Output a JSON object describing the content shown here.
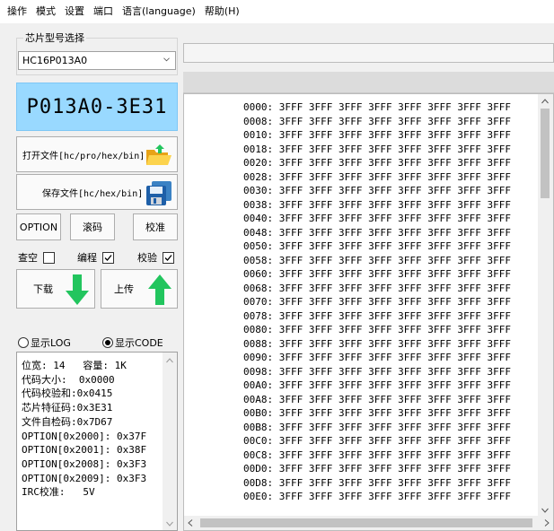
{
  "menu": [
    "操作",
    "模式",
    "设置",
    "端口",
    "语言(language)",
    "帮助(H)"
  ],
  "chip_select": {
    "legend": "芯片型号选择",
    "value": "HC16P013A0"
  },
  "chip_display": "P013A0-3E31",
  "buttons": {
    "open_file": "打开文件[hc/pro/hex/bin]",
    "save_file": "保存文件[hc/hex/bin]",
    "option": "OPTION",
    "roll_code": "滚码",
    "verify": "校准",
    "download": "下载",
    "upload": "上传"
  },
  "checkboxes": [
    {
      "label": "查空",
      "checked": false
    },
    {
      "label": "编程",
      "checked": true
    },
    {
      "label": "校验",
      "checked": true
    }
  ],
  "radios": [
    {
      "label": "显示LOG",
      "selected": false
    },
    {
      "label": "显示CODE",
      "selected": true
    }
  ],
  "info_lines": [
    "位宽: 14   容量: 1K",
    "代码大小:  0x0000",
    "代码校验和:0x0415",
    "芯片特征码:0x3E31",
    "文件自检码:0x7D67",
    "OPTION[0x2000]: 0x37F",
    "OPTION[0x2001]: 0x38F",
    "OPTION[0x2008]: 0x3F3",
    "OPTION[0x2009]: 0x3F3",
    "IRC校准:   5V"
  ],
  "hex_fill": "3FFF",
  "hex_addresses": [
    "0000",
    "0008",
    "0010",
    "0018",
    "0020",
    "0028",
    "0030",
    "0038",
    "0040",
    "0048",
    "0050",
    "0058",
    "0060",
    "0068",
    "0070",
    "0078",
    "0080",
    "0088",
    "0090",
    "0098",
    "00A0",
    "00A8",
    "00B0",
    "00B8",
    "00C0",
    "00C8",
    "00D0",
    "00D8",
    "00E0"
  ],
  "colors": {
    "chip_display_bg": "#99d9ff",
    "arrow_green": "#22c55e"
  }
}
